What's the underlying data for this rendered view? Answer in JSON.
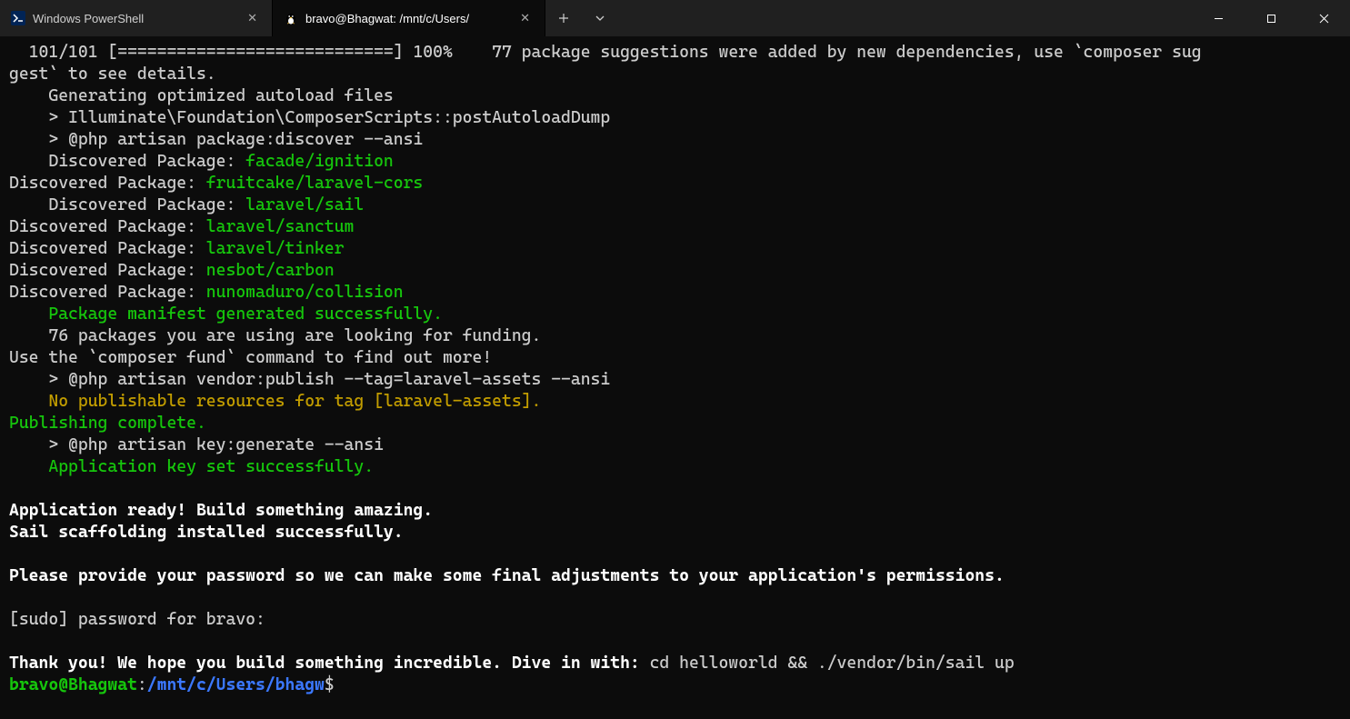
{
  "titlebar": {
    "tabs": [
      {
        "label": "Windows PowerShell"
      },
      {
        "label": "bravo@Bhagwat: /mnt/c/Users/"
      }
    ]
  },
  "terminal": {
    "progress_line_a": "  101/101 [============================] 100%    77 package suggestions were added by new dependencies, use `composer sug",
    "progress_line_b": "gest` to see details.",
    "gen_autoload": "    Generating optimized autoload files",
    "post_autoload": "    > Illuminate\\Foundation\\ComposerScripts::postAutoloadDump",
    "artisan_discover": "    > @php artisan package:discover --ansi",
    "disc1_label": "    Discovered Package: ",
    "disc1_pkg": "facade/ignition",
    "disc2_label": "Discovered Package: ",
    "disc2_pkg": "fruitcake/laravel-cors",
    "disc3_label": "    Discovered Package: ",
    "disc3_pkg": "laravel/sail",
    "disc4_label": "Discovered Package: ",
    "disc4_pkg": "laravel/sanctum",
    "disc5_label": "Discovered Package: ",
    "disc5_pkg": "laravel/tinker",
    "disc6_label": "Discovered Package: ",
    "disc6_pkg": "nesbot/carbon",
    "disc7_label": "Discovered Package: ",
    "disc7_pkg": "nunomaduro/collision",
    "manifest": "    Package manifest generated successfully.",
    "funding": "    76 packages you are using are looking for funding.",
    "fund_cmd": "Use the `composer fund` command to find out more!",
    "vendor_publish": "    > @php artisan vendor:publish --tag=laravel-assets --ansi",
    "no_publish": "    No publishable resources for tag [laravel-assets].",
    "publish_complete": "Publishing complete.",
    "key_gen": "    > @php artisan key:generate --ansi",
    "key_set": "    Application key set successfully.",
    "app_ready": "Application ready! Build something amazing.",
    "sail_scaffold": "Sail scaffolding installed successfully.",
    "pwd_prompt": "Please provide your password so we can make some final adjustments to your application's permissions.",
    "sudo": "[sudo] password for bravo:",
    "thankyou_a": "Thank you! We hope you build something incredible. Dive in with:",
    "thankyou_b": " cd helloworld && ./vendor/bin/sail up",
    "prompt_user": "bravo@Bhagwat",
    "prompt_colon": ":",
    "prompt_path": "/mnt/c/Users/bhagw",
    "prompt_dollar": "$"
  }
}
